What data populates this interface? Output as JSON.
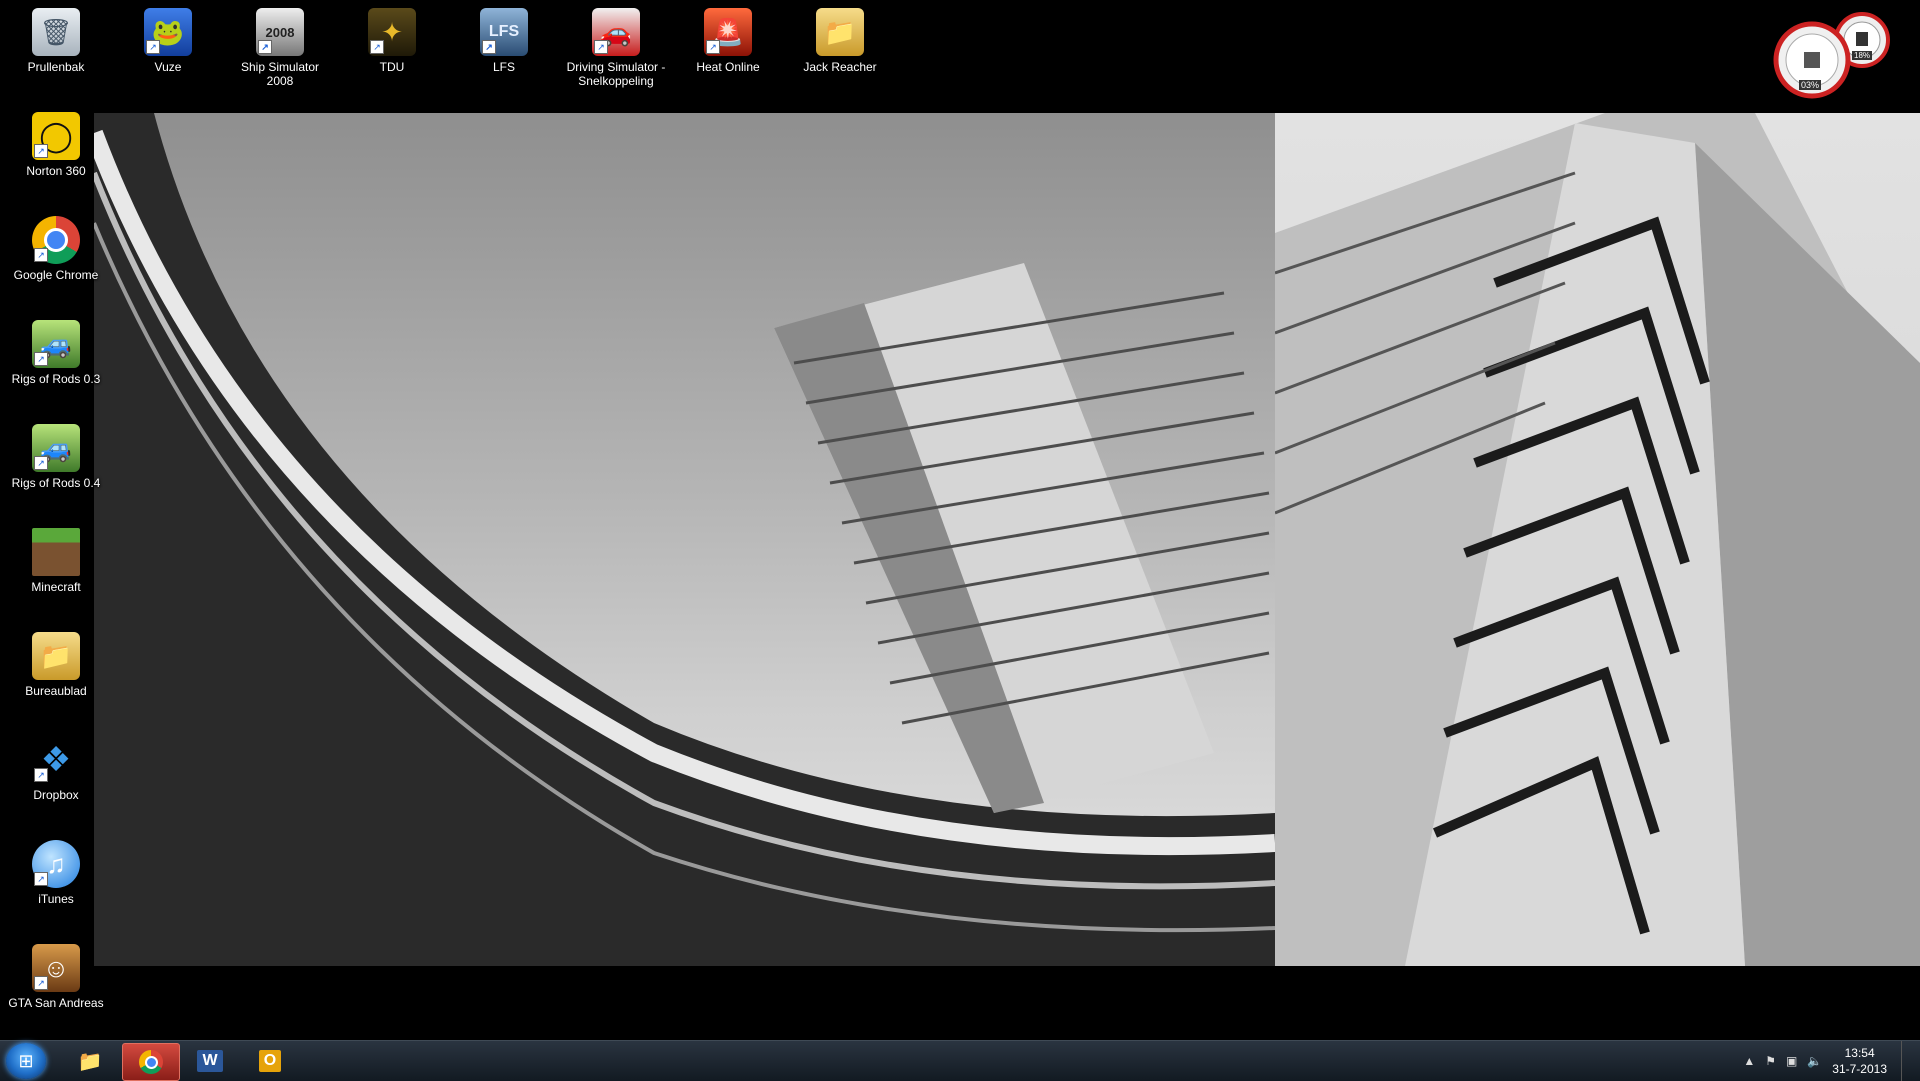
{
  "desktop": {
    "icons_top": [
      {
        "label": "Prullenbak",
        "icon": "recycle-bin-icon"
      },
      {
        "label": "Vuze",
        "icon": "vuze-icon"
      },
      {
        "label": "Ship Simulator 2008",
        "icon": "ship-simulator-icon"
      },
      {
        "label": "TDU",
        "icon": "tdu-icon"
      },
      {
        "label": "LFS",
        "icon": "lfs-icon"
      },
      {
        "label": "Driving Simulator - Snelkoppeling",
        "icon": "driving-simulator-icon"
      },
      {
        "label": "Heat Online",
        "icon": "heat-online-icon"
      },
      {
        "label": "Jack Reacher",
        "icon": "folder-icon"
      }
    ],
    "icons_left": [
      {
        "label": "Norton 360",
        "icon": "norton-icon"
      },
      {
        "label": "Google Chrome",
        "icon": "chrome-icon"
      },
      {
        "label": "Rigs of Rods 0.3",
        "icon": "rigs-of-rods-icon"
      },
      {
        "label": "Rigs of Rods 0.4",
        "icon": "rigs-of-rods-icon"
      },
      {
        "label": "Minecraft",
        "icon": "minecraft-icon"
      },
      {
        "label": "Bureaublad",
        "icon": "folder-icon"
      },
      {
        "label": "Dropbox",
        "icon": "dropbox-icon"
      },
      {
        "label": "iTunes",
        "icon": "itunes-icon"
      },
      {
        "label": "GTA San Andreas",
        "icon": "gta-icon"
      }
    ]
  },
  "gadget": {
    "cpu_label": "03%",
    "ram_label": "18%"
  },
  "taskbar": {
    "pinned": [
      {
        "name": "explorer",
        "icon": "folder-icon",
        "active": false
      },
      {
        "name": "chrome",
        "icon": "chrome-icon",
        "active": true
      },
      {
        "name": "word",
        "icon": "word-icon",
        "active": false
      },
      {
        "name": "outlook",
        "icon": "outlook-icon",
        "active": false
      }
    ],
    "clock": {
      "time": "13:54",
      "date": "31-7-2013"
    }
  },
  "colors": {
    "taskbar_active": "#c0392b",
    "start_orb": "#1f6ec7"
  }
}
